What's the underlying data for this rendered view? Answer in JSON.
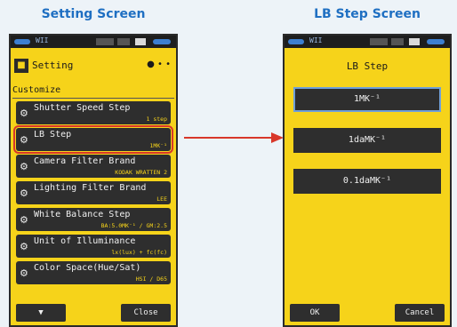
{
  "captions": {
    "left": "Setting Screen",
    "right": "LB Step Screen"
  },
  "setting_screen": {
    "title": "Setting",
    "title_icon": "settings-folder-icon",
    "page_indicator": "● • •",
    "section": "Customize",
    "items": [
      {
        "label": "Shutter Speed Step",
        "value": "1 step"
      },
      {
        "label": "LB Step",
        "value": "1MK⁻¹"
      },
      {
        "label": "Camera Filter Brand",
        "value": "KODAK WRATTEN 2"
      },
      {
        "label": "Lighting Filter Brand",
        "value": "LEE"
      },
      {
        "label": "White Balance Step",
        "value": "BA:5.0MK⁻¹ / GM:2.5"
      },
      {
        "label": "Unit of Illuminance",
        "value": "lx(lux) + fc(fc)"
      },
      {
        "label": "Color Space(Hue/Sat)",
        "value": "HSI / D65"
      }
    ],
    "selected_index": 1,
    "buttons": {
      "down": "▼",
      "close": "Close"
    }
  },
  "lb_step_screen": {
    "title": "LB Step",
    "options": [
      "1MK⁻¹",
      "1daMK⁻¹",
      "0.1daMK⁻¹"
    ],
    "selected_index": 0,
    "buttons": {
      "ok": "OK",
      "cancel": "Cancel"
    }
  },
  "status_bar": {
    "left_text": "WII"
  },
  "colors": {
    "screen_bg": "#f6d31a",
    "item_bg": "#2e2e2e",
    "highlight": "#d8372a",
    "caption": "#1f6fc2"
  }
}
